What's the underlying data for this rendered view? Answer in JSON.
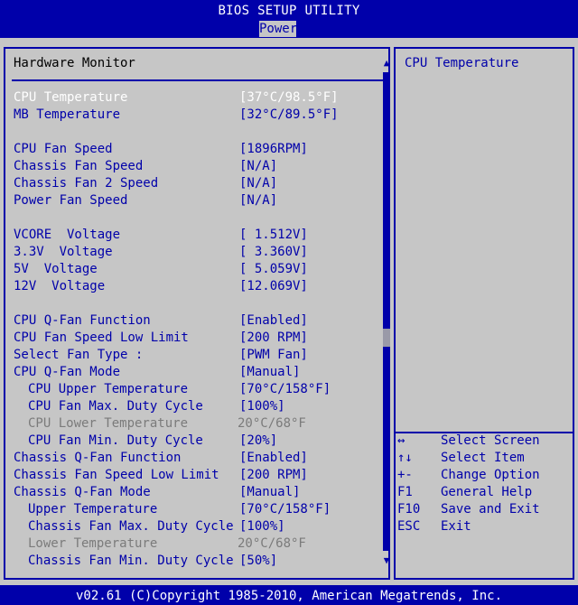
{
  "header": {
    "title": "BIOS SETUP UTILITY",
    "tab": "Power"
  },
  "panel": {
    "heading": "Hardware Monitor"
  },
  "items": [
    {
      "label": "CPU Temperature",
      "value": "[37°C/98.5°F]"
    },
    {
      "label": "MB Temperature",
      "value": "[32°C/89.5°F]"
    },
    {
      "label": "CPU Fan Speed",
      "value": "[1896RPM]"
    },
    {
      "label": "Chassis Fan Speed",
      "value": "[N/A]"
    },
    {
      "label": "Chassis Fan 2 Speed",
      "value": "[N/A]"
    },
    {
      "label": "Power Fan Speed",
      "value": "[N/A]"
    },
    {
      "label": "VCORE  Voltage",
      "value": "[ 1.512V]"
    },
    {
      "label": "3.3V  Voltage",
      "value": "[ 3.360V]"
    },
    {
      "label": "5V  Voltage",
      "value": "[ 5.059V]"
    },
    {
      "label": "12V  Voltage",
      "value": "[12.069V]"
    },
    {
      "label": "CPU Q-Fan Function",
      "value": "[Enabled]"
    },
    {
      "label": "CPU Fan Speed Low Limit",
      "value": "[200 RPM]"
    },
    {
      "label": "Select Fan Type :",
      "value": "[PWM Fan]"
    },
    {
      "label": "CPU Q-Fan Mode",
      "value": "[Manual]"
    },
    {
      "label": "CPU Upper Temperature",
      "value": "[70°C/158°F]"
    },
    {
      "label": "CPU Fan Max. Duty Cycle",
      "value": "[100%]"
    },
    {
      "label": "CPU Lower Temperature",
      "value": "20°C/68°F"
    },
    {
      "label": "CPU Fan Min. Duty Cycle",
      "value": "[20%]"
    },
    {
      "label": "Chassis Q-Fan Function",
      "value": "[Enabled]"
    },
    {
      "label": "Chassis Fan Speed Low Limit",
      "value": "[200 RPM]"
    },
    {
      "label": "Chassis Q-Fan Mode",
      "value": "[Manual]"
    },
    {
      "label": "Upper Temperature",
      "value": "[70°C/158°F]"
    },
    {
      "label": "Chassis Fan Max. Duty Cycle",
      "value": "[100%]"
    },
    {
      "label": "Lower Temperature",
      "value": "20°C/68°F"
    },
    {
      "label": "Chassis Fan Min. Duty Cycle",
      "value": "[50%]"
    }
  ],
  "help": {
    "title": "CPU Temperature",
    "keys": [
      {
        "key": "↔",
        "desc": "Select Screen"
      },
      {
        "key": "↑↓",
        "desc": "Select Item"
      },
      {
        "key": "+-",
        "desc": "Change Option"
      },
      {
        "key": "F1",
        "desc": "General Help"
      },
      {
        "key": "F10",
        "desc": "Save and Exit"
      },
      {
        "key": "ESC",
        "desc": "Exit"
      }
    ]
  },
  "scroll": {
    "up_arrow": "▲",
    "down_arrow": "▼"
  },
  "footer": {
    "text": "v02.61 (C)Copyright 1985-2010, American Megatrends, Inc."
  },
  "colors": {
    "bios_blue": "#0000aa",
    "panel_gray": "#c6c6c6",
    "selected_text": "#ffffff",
    "disabled_text": "#7b7b7b"
  }
}
